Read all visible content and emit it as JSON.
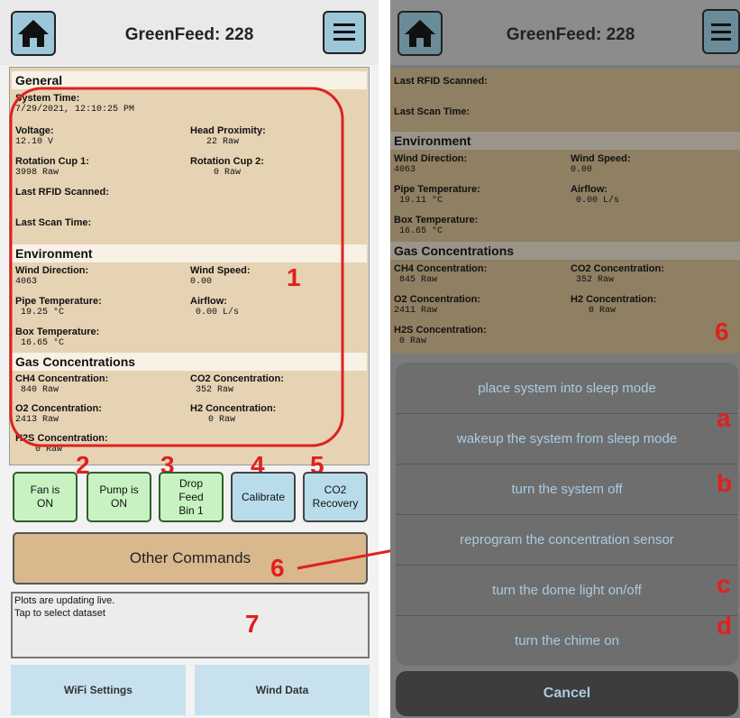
{
  "left": {
    "header": {
      "title": "GreenFeed: 228",
      "home_icon": "home-icon",
      "menu_icon": "hamburger-icon"
    },
    "general": {
      "title": "General",
      "system_time": {
        "label": "System Time:",
        "value": "7/29/2021, 12:10:25 PM"
      },
      "voltage": {
        "label": "Voltage:",
        "value": "12.10 V"
      },
      "head_proximity": {
        "label": "Head Proximity:",
        "value": "22 Raw"
      },
      "rotation_cup1": {
        "label": "Rotation Cup 1:",
        "value": "3998 Raw"
      },
      "rotation_cup2": {
        "label": "Rotation Cup 2:",
        "value": "0 Raw"
      },
      "last_rfid": {
        "label": "Last RFID Scanned:"
      },
      "last_scan": {
        "label": "Last Scan Time:"
      }
    },
    "environment": {
      "title": "Environment",
      "wind_direction": {
        "label": "Wind Direction:",
        "value": "4063"
      },
      "wind_speed": {
        "label": "Wind Speed:",
        "value": "0.00"
      },
      "pipe_temp": {
        "label": "Pipe Temperature:",
        "value": "19.25 °C"
      },
      "airflow": {
        "label": "Airflow:",
        "value": "0.00 L/s"
      },
      "box_temp": {
        "label": "Box Temperature:",
        "value": "16.65 °C"
      }
    },
    "gas": {
      "title": "Gas Concentrations",
      "ch4": {
        "label": "CH4 Concentration:",
        "value": "840 Raw"
      },
      "co2": {
        "label": "CO2 Concentration:",
        "value": "352 Raw"
      },
      "o2": {
        "label": "O2 Concentration:",
        "value": "2413 Raw"
      },
      "h2": {
        "label": "H2 Concentration:",
        "value": "0 Raw"
      },
      "h2s": {
        "label": "H2S Concentration:",
        "value": "0 Raw"
      }
    },
    "buttons": {
      "fan": "Fan is ON",
      "pump": "Pump is ON",
      "drop_feed": "Drop Feed Bin 1",
      "calibrate": "Calibrate",
      "co2_recovery": "CO2 Recovery",
      "other_commands": "Other Commands"
    },
    "plots": {
      "line1": "Plots are updating live.",
      "line2": "Tap to select dataset"
    },
    "tabs": {
      "wifi": "WiFi Settings",
      "wind": "Wind Data"
    },
    "annotations": {
      "n1": "1",
      "n2": "2",
      "n3": "3",
      "n4": "4",
      "n5": "5",
      "n6": "6",
      "n7": "7"
    }
  },
  "right": {
    "header": {
      "title": "GreenFeed: 228"
    },
    "info": {
      "last_rfid": "Last RFID Scanned:",
      "last_scan": "Last Scan Time:",
      "environment": "Environment",
      "wind_direction": {
        "label": "Wind Direction:",
        "value": "4063"
      },
      "wind_speed": {
        "label": "Wind Speed:",
        "value": "0.00"
      },
      "pipe_temp": {
        "label": "Pipe Temperature:",
        "value": "19.11 °C"
      },
      "airflow": {
        "label": "Airflow:",
        "value": "0.00 L/s"
      },
      "box_temp": {
        "label": "Box Temperature:",
        "value": "16.65 °C"
      },
      "gas": "Gas Concentrations",
      "ch4": {
        "label": "CH4 Concentration:",
        "value": "845 Raw"
      },
      "co2": {
        "label": "CO2 Concentration:",
        "value": "352 Raw"
      },
      "o2": {
        "label": "O2 Concentration:",
        "value": "2411 Raw"
      },
      "h2": {
        "label": "H2 Concentration:",
        "value": "0 Raw"
      },
      "h2s": {
        "label": "H2S Concentration:",
        "value": "0 Raw"
      }
    },
    "menu": [
      "place system into sleep mode",
      "wakeup the system from sleep mode",
      "turn the system off",
      "reprogram the concentration sensor",
      "turn the dome light on/off",
      "turn the chime on"
    ],
    "cancel": "Cancel",
    "annotations": {
      "n6": "6",
      "a": "a",
      "b": "b",
      "c": "c",
      "d": "d"
    }
  },
  "colors": {
    "annotation_red": "#e0201e",
    "panel_tan": "#e6d3b4",
    "button_green": "#c8f2c2",
    "button_blue": "#b9dceb"
  }
}
